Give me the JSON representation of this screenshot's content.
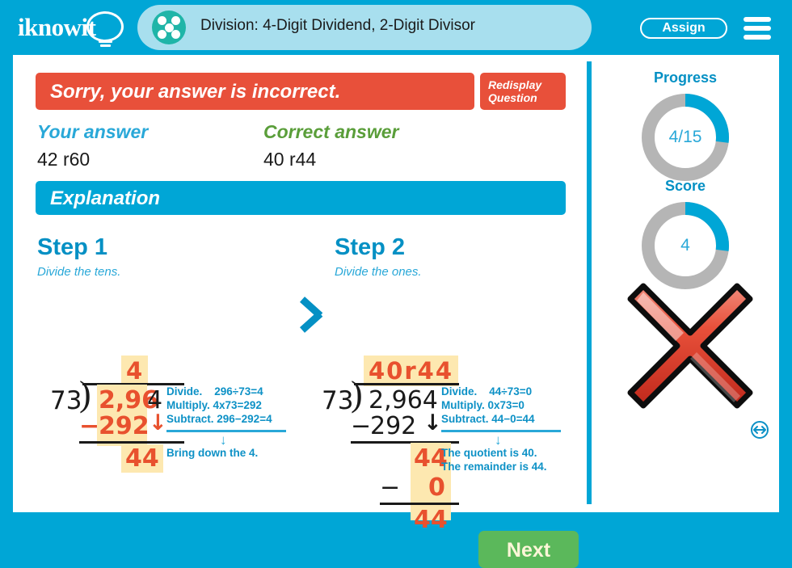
{
  "header": {
    "logo_text": "iknowit",
    "logo_icon": "lightbulb-icon",
    "title": "Division: 4-Digit Dividend, 2-Digit Divisor",
    "title_icon": "dice-five-dots-icon",
    "assign_label": "Assign",
    "menu_icon": "hamburger-menu-icon",
    "brand_color": "#00a6d6",
    "band_color": "#a8dfee"
  },
  "feedback": {
    "banner_text": "Sorry, your answer is incorrect.",
    "banner_color": "#e8503a",
    "redisplay_label": "Redisplay\nQuestion",
    "your_answer_label": "Your answer",
    "your_answer_value": "42 r60",
    "your_answer_color": "#29a8d8",
    "correct_answer_label": "Correct answer",
    "correct_answer_value": "40 r44",
    "correct_answer_color": "#5a9e3a"
  },
  "explanation": {
    "heading": "Explanation",
    "steps": [
      {
        "title": "Step 1",
        "subtitle": "Divide the tens.",
        "quotient": "4",
        "divisor": "73",
        "dividend_highlight": "2,96",
        "dividend_tail": "4",
        "subtract_sign": "−",
        "subtract_value": "292",
        "bring_down_arrow": "↓",
        "difference": "44",
        "notes": [
          "Divide.    296÷73=4",
          "Multiply. 4x73=292",
          "Subtract. 296−292=4"
        ],
        "conclusion": [
          "Bring down the 4."
        ]
      },
      {
        "title": "Step 2",
        "subtitle": "Divide the ones.",
        "quotient": "40r44",
        "divisor": "73",
        "dividend": "2,964",
        "subtract_sign": "−",
        "subtract_value": "292",
        "bring_down_arrow": "↓",
        "difference": "44",
        "second_sign": "−",
        "second_value": "0",
        "remainder": "44",
        "notes": [
          "Divide.    44÷73=0",
          "Multiply. 0x73=0",
          "Subtract. 44−0=44"
        ],
        "conclusion": [
          "The quotient is 40.",
          "The remainder is 44."
        ]
      }
    ],
    "highlight_color": "#fde8b0",
    "orange_color": "#e8512e",
    "note_color": "#0d91c6"
  },
  "actions": {
    "next_label": "Next",
    "next_color": "#5bb85b"
  },
  "sidebar": {
    "progress_label": "Progress",
    "progress_value": "4/15",
    "progress_percent": 27,
    "score_label": "Score",
    "score_value": "4",
    "score_percent": 27,
    "ring_fill_color": "#00a6d6",
    "ring_track_color": "#b5b5b5",
    "result_icon": "red-x-incorrect-icon",
    "resize_icon": "resize-horizontal-icon"
  }
}
